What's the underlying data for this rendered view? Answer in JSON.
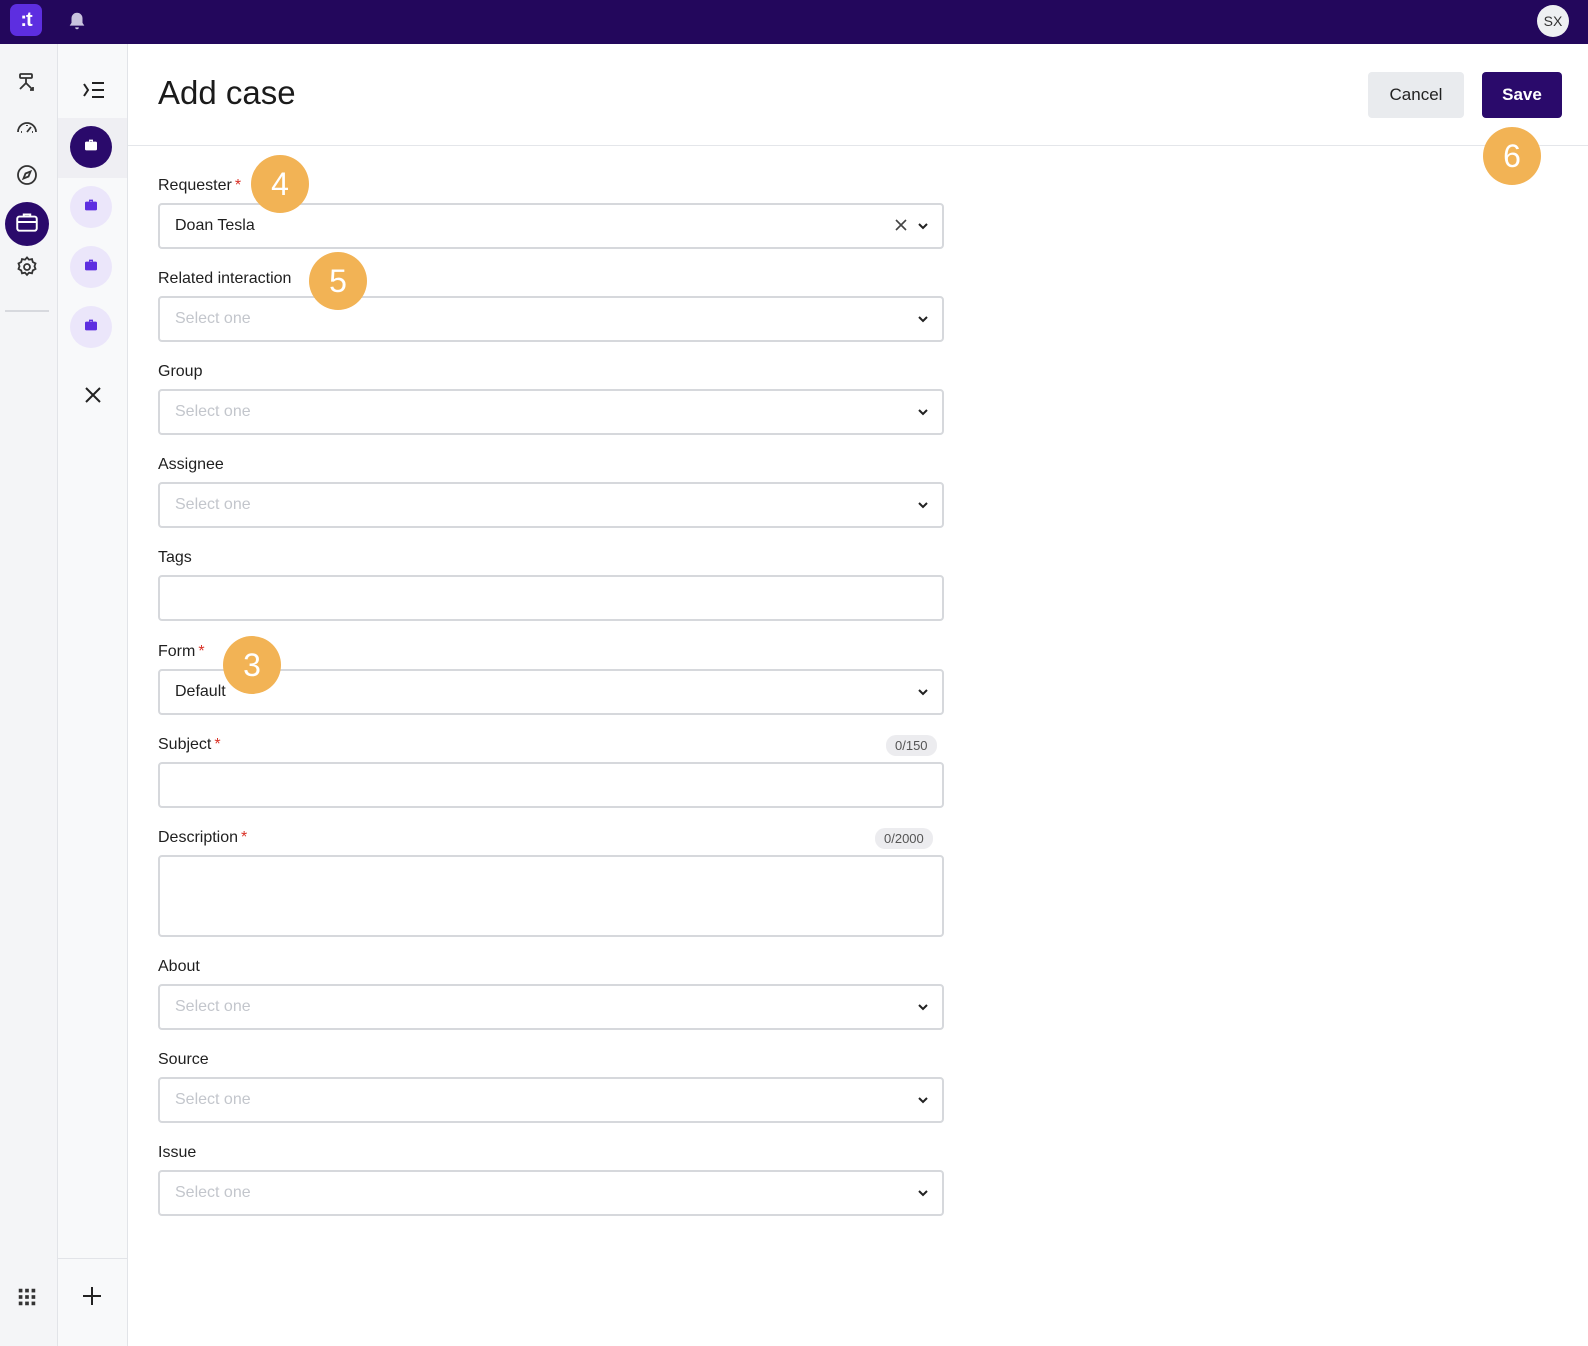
{
  "topbar": {
    "logo_text": ":t",
    "avatar_initials": "SX"
  },
  "header": {
    "title": "Add case",
    "cancel_label": "Cancel",
    "save_label": "Save"
  },
  "form": {
    "requester": {
      "label": "Requester",
      "value": "Doan Tesla"
    },
    "related_interaction": {
      "label": "Related interaction",
      "placeholder": "Select one"
    },
    "group": {
      "label": "Group",
      "placeholder": "Select one"
    },
    "assignee": {
      "label": "Assignee",
      "placeholder": "Select one"
    },
    "tags": {
      "label": "Tags"
    },
    "form": {
      "label": "Form",
      "value": "Default"
    },
    "subject": {
      "label": "Subject",
      "counter": "0/150"
    },
    "description": {
      "label": "Description",
      "counter": "0/2000"
    },
    "about": {
      "label": "About",
      "placeholder": "Select one"
    },
    "source": {
      "label": "Source",
      "placeholder": "Select one"
    },
    "issue": {
      "label": "Issue",
      "placeholder": "Select one"
    },
    "required_mark": "*"
  },
  "annotations": {
    "n3": "3",
    "n4": "4",
    "n5": "5",
    "n6": "6"
  },
  "colors": {
    "brand_dark": "#23075c",
    "accent": "#2a0a6b",
    "badge": "#f2b355",
    "required": "#d93025"
  },
  "icons": [
    "bell-icon",
    "workflow-icon",
    "dashboard-icon",
    "compass-icon",
    "briefcase-icon",
    "gear-icon",
    "grid-icon",
    "collapse-menu-icon",
    "close-icon",
    "plus-icon",
    "chevron-down-icon",
    "clear-icon"
  ]
}
